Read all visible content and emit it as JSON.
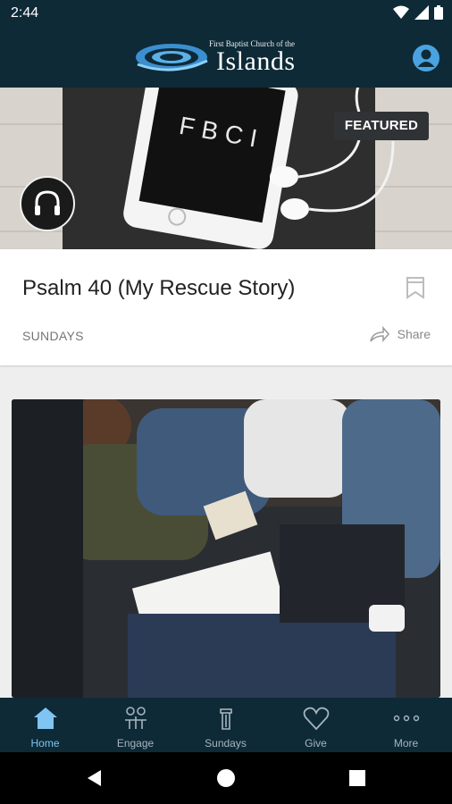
{
  "status_bar": {
    "time": "2:44"
  },
  "header": {
    "logo_small": "First Baptist Church of the",
    "logo_big": "Islands"
  },
  "hero": {
    "badge": "FEATURED",
    "phone_text": "FBCI"
  },
  "featured_item": {
    "title": "Psalm 40 (My Rescue Story)",
    "category": "SUNDAYS",
    "share_label": "Share"
  },
  "nav": {
    "items": [
      {
        "label": "Home"
      },
      {
        "label": "Engage"
      },
      {
        "label": "Sundays"
      },
      {
        "label": "Give"
      },
      {
        "label": "More"
      }
    ]
  },
  "colors": {
    "primary": "#0e2a37",
    "accent": "#4aa3e0",
    "nav_inactive": "#a6b5bd"
  }
}
